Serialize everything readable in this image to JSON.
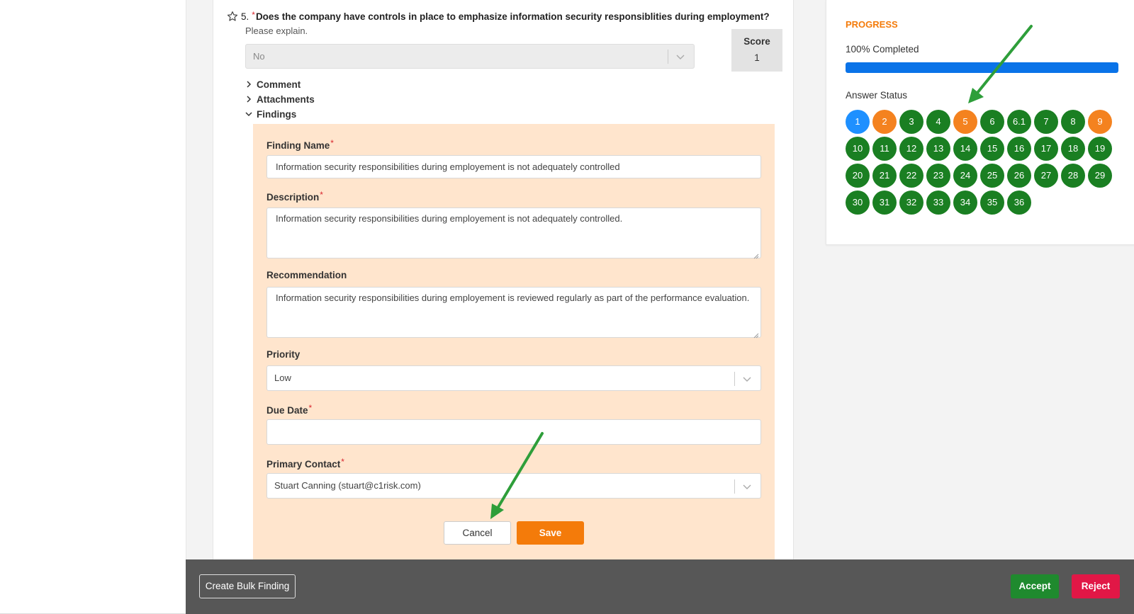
{
  "question": {
    "number": "5.",
    "required_mark": "*",
    "text": "Does the company have controls in place to emphasize information security responsiblities during employment?",
    "hint": "Please explain.",
    "answer_value": "No",
    "score_label": "Score",
    "score_value": "1"
  },
  "sections": {
    "comment": "Comment",
    "attachments": "Attachments",
    "findings": "Findings"
  },
  "finding_form": {
    "name_label": "Finding Name",
    "name_value": "Information security responsibilities during employement is not adequately controlled",
    "description_label": "Description",
    "description_value": "Information security responsibilities during employement is not adequately controlled.",
    "recommendation_label": "Recommendation",
    "recommendation_value": "Information security responsibilities during employement is reviewed regularly as part of the performance evaluation.",
    "priority_label": "Priority",
    "priority_value": "Low",
    "due_date_label": "Due Date",
    "due_date_value": "",
    "contact_label": "Primary Contact",
    "contact_value": "Stuart Canning (stuart@c1risk.com)",
    "required_mark": "*",
    "cancel_label": "Cancel",
    "save_label": "Save"
  },
  "progress": {
    "title": "PROGRESS",
    "completed_text": "100% Completed",
    "fraction": 1.0,
    "answer_status_title": "Answer Status",
    "items": [
      {
        "label": "1",
        "status": "current"
      },
      {
        "label": "2",
        "status": "flagged"
      },
      {
        "label": "3",
        "status": "answered"
      },
      {
        "label": "4",
        "status": "answered"
      },
      {
        "label": "5",
        "status": "flagged"
      },
      {
        "label": "6",
        "status": "answered"
      },
      {
        "label": "6.1",
        "status": "answered"
      },
      {
        "label": "7",
        "status": "answered"
      },
      {
        "label": "8",
        "status": "answered"
      },
      {
        "label": "9",
        "status": "flagged"
      },
      {
        "label": "10",
        "status": "answered"
      },
      {
        "label": "11",
        "status": "answered"
      },
      {
        "label": "12",
        "status": "answered"
      },
      {
        "label": "13",
        "status": "answered"
      },
      {
        "label": "14",
        "status": "answered"
      },
      {
        "label": "15",
        "status": "answered"
      },
      {
        "label": "16",
        "status": "answered"
      },
      {
        "label": "17",
        "status": "answered"
      },
      {
        "label": "18",
        "status": "answered"
      },
      {
        "label": "19",
        "status": "answered"
      },
      {
        "label": "20",
        "status": "answered"
      },
      {
        "label": "21",
        "status": "answered"
      },
      {
        "label": "22",
        "status": "answered"
      },
      {
        "label": "23",
        "status": "answered"
      },
      {
        "label": "24",
        "status": "answered"
      },
      {
        "label": "25",
        "status": "answered"
      },
      {
        "label": "26",
        "status": "answered"
      },
      {
        "label": "27",
        "status": "answered"
      },
      {
        "label": "28",
        "status": "answered"
      },
      {
        "label": "29",
        "status": "answered"
      },
      {
        "label": "30",
        "status": "answered"
      },
      {
        "label": "31",
        "status": "answered"
      },
      {
        "label": "32",
        "status": "answered"
      },
      {
        "label": "33",
        "status": "answered"
      },
      {
        "label": "34",
        "status": "answered"
      },
      {
        "label": "35",
        "status": "answered"
      },
      {
        "label": "36",
        "status": "answered"
      }
    ],
    "status_colors": {
      "current": "#1e90ff",
      "flagged": "#f4821f",
      "answered": "#1a7f22"
    }
  },
  "footer": {
    "bulk_label": "Create Bulk Finding",
    "accept_label": "Accept",
    "reject_label": "Reject"
  },
  "colors": {
    "accent_orange": "#f47b0a",
    "progress_blue": "#0a73e8",
    "findings_bg": "#ffe5cd",
    "annotation_arrow": "#2e9e3a"
  }
}
